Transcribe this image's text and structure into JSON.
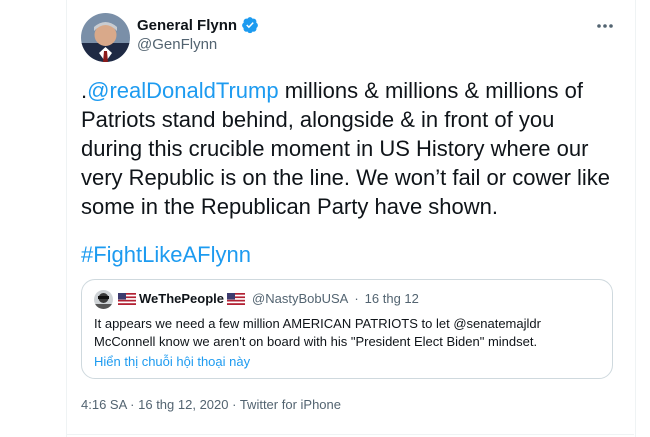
{
  "tweet": {
    "display_name": "General Flynn",
    "handle": "@GenFlynn",
    "text_prefix": ".",
    "mention": "@realDonaldTrump",
    "text_body": " millions & millions & millions of Patriots stand behind, alongside & in front of you during this crucible moment in US History where our very Republic is on the line. We won’t fail or cower like some in the Republican Party have shown.",
    "hashtag": "#FightLikeAFlynn",
    "time": "4:16 SA",
    "date": "16 thg 12, 2020",
    "source": "Twitter for iPhone"
  },
  "quote": {
    "display_name": "WeThePeople",
    "handle": "@NastyBobUSA",
    "date": "16 thg 12",
    "text": "It appears we need a few million AMERICAN PATRIOTS to let @senatemajldr McConnell know we aren't on board with his \"President Elect Biden\" mindset.",
    "thread_link": "Hiển thị chuỗi hội thoại này"
  },
  "icons": {
    "verified": "verified-badge-icon",
    "more": "more-options-icon",
    "flag": "us-flag-icon"
  },
  "colors": {
    "accent": "#1d9bf0",
    "text": "#0f1419",
    "muted": "#536471",
    "border": "#cfd9de"
  }
}
